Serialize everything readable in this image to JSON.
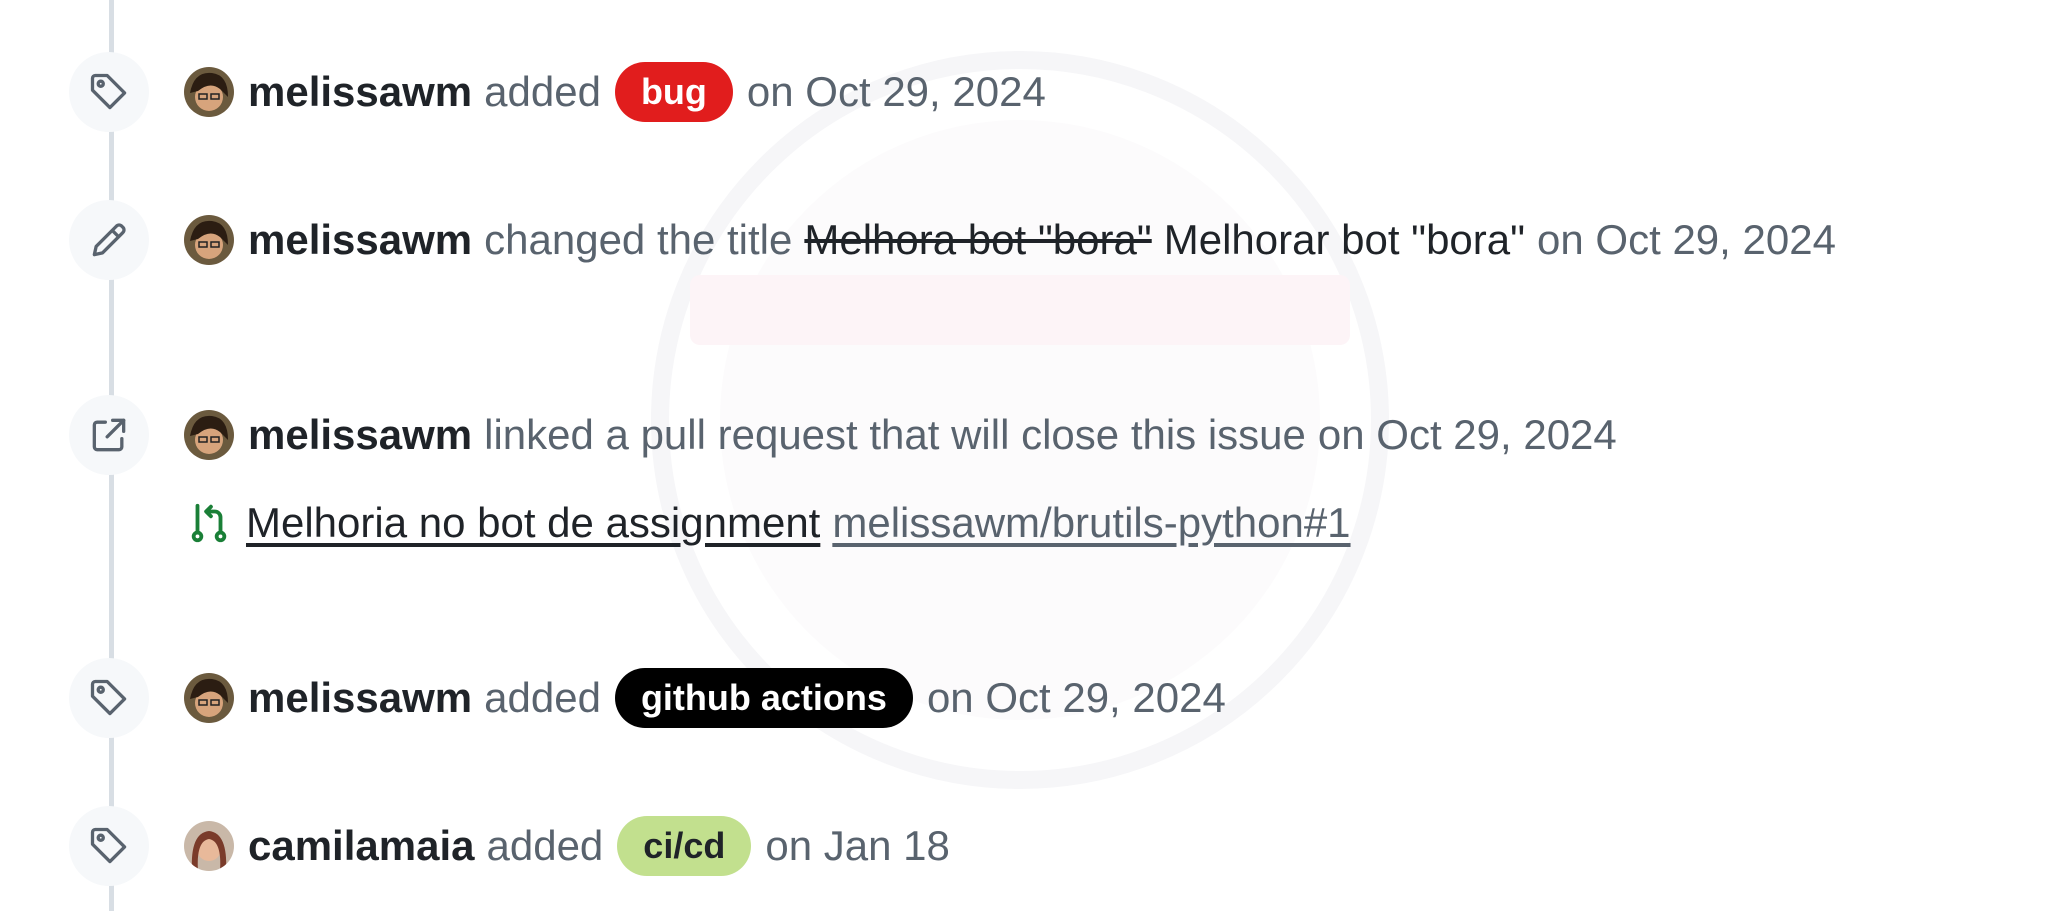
{
  "events": [
    {
      "icon": "tag-icon",
      "author": "melissawm",
      "action": "added",
      "label": {
        "text": "bug",
        "bg": "#e11d1d",
        "fg": "#ffffff"
      },
      "date": "on Oct 29, 2024"
    },
    {
      "icon": "pencil-icon",
      "author": "melissawm",
      "action": "changed the title",
      "old_title": "Melhora bot \"bora\"",
      "new_title": "Melhorar bot \"bora\"",
      "date": "on Oct 29, 2024"
    },
    {
      "icon": "link-external-icon",
      "author": "melissawm",
      "action": "linked a pull request that will close this issue",
      "date": "on Oct 29, 2024",
      "pull_request": {
        "icon": "git-pull-request-icon",
        "title": "Melhoria no bot de assignment",
        "ref": "melissawm/brutils-python#1"
      }
    },
    {
      "icon": "tag-icon",
      "author": "melissawm",
      "action": "added",
      "label": {
        "text": "github actions",
        "bg": "#000000",
        "fg": "#ffffff"
      },
      "date": "on Oct 29, 2024"
    },
    {
      "icon": "tag-icon",
      "author": "camilamaia",
      "action": "added",
      "label": {
        "text": "ci/cd",
        "bg": "#c2e08e",
        "fg": "#1f2328"
      },
      "date": "on Jan 18"
    }
  ],
  "colors": {
    "text_primary": "#1f2328",
    "text_muted": "#59636e",
    "timeline": "#d8dee4",
    "icon_badge_bg": "#f6f8fa",
    "pr_open_green": "#1a7f37"
  }
}
